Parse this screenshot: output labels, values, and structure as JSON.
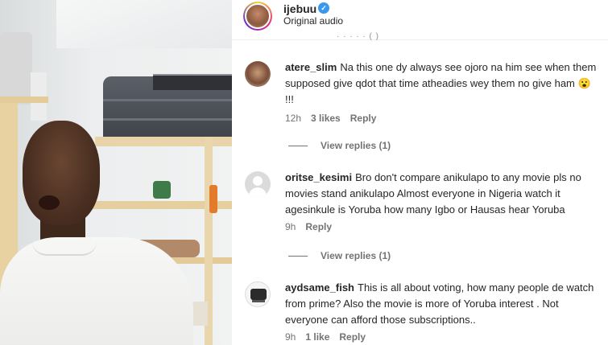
{
  "header": {
    "username": "ijebuu",
    "audio_label": "Original audio",
    "partial_text": "· · · · · ( )"
  },
  "comments": [
    {
      "username": "atere_slim",
      "text": "Na this one dy always see ojoro na him see when them supposed give qdot that time atheadies wey them no give ham 😮 !!!",
      "time": "12h",
      "likes": "3 likes",
      "reply_label": "Reply",
      "view_replies": "View replies (1)"
    },
    {
      "username": "oritse_kesimi",
      "text": "Bro don't compare anikulapo to any movie pls no movies stand anikulapo Almost everyone in Nigeria watch it agesinkule is Yoruba how many Igbo or Hausas hear Yoruba",
      "time": "9h",
      "likes": "",
      "reply_label": "Reply",
      "view_replies": "View replies (1)"
    },
    {
      "username": "aydsame_fish",
      "text": "This is all about voting, how many people de watch from prime? Also the movie is more of Yoruba interest . Not everyone can afford those subscriptions..",
      "time": "9h",
      "likes": "1 like",
      "reply_label": "Reply",
      "view_replies": ""
    }
  ],
  "colors": {
    "verified": "#3897f0",
    "text": "#262626",
    "muted": "#737373"
  },
  "icons": {
    "verified": "verified-badge-icon",
    "default_avatar": "default-avatar-icon"
  }
}
